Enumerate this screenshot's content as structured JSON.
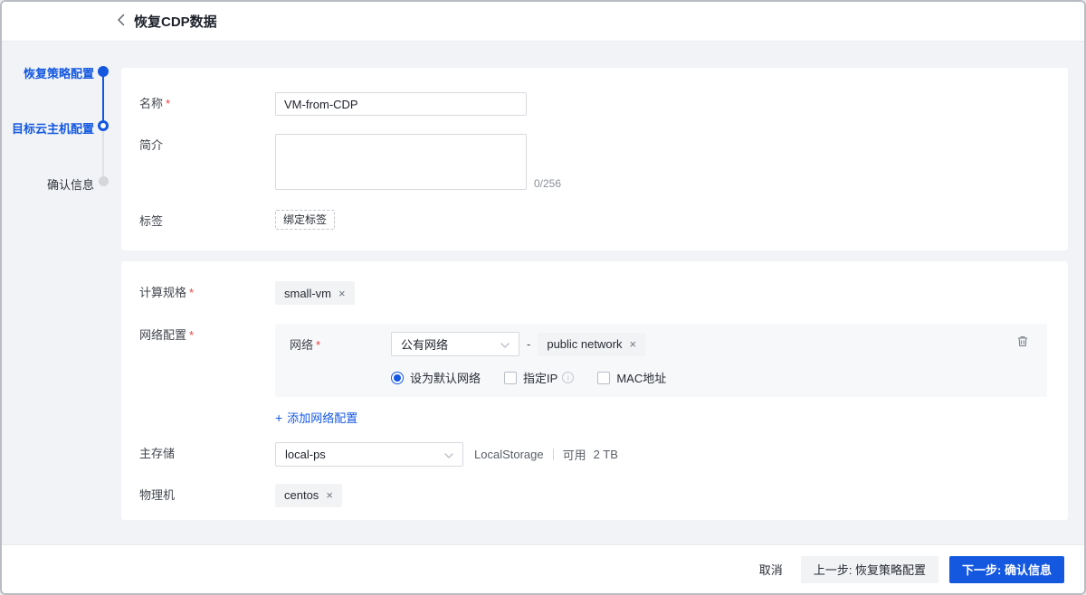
{
  "header": {
    "title": "恢复CDP数据"
  },
  "stepper": {
    "steps": [
      {
        "label": "恢复策略配置",
        "state": "done"
      },
      {
        "label": "目标云主机配置",
        "state": "current"
      },
      {
        "label": "确认信息",
        "state": "pending"
      }
    ]
  },
  "form": {
    "required_mark": "*",
    "name": {
      "label": "名称",
      "value": "VM-from-CDP"
    },
    "description": {
      "label": "简介",
      "value": "",
      "counter": "0/256"
    },
    "tag": {
      "label": "标签",
      "bind_button": "绑定标签"
    },
    "instance_offering": {
      "label": "计算规格",
      "tag": "small-vm",
      "remove": "×"
    },
    "network_config": {
      "label": "网络配置",
      "network": {
        "label": "网络",
        "select_value": "公有网络",
        "dash": "-",
        "tag": "public network",
        "remove": "×"
      },
      "options": {
        "default_network": "设为默认网络",
        "specify_ip": "指定IP",
        "info": "i",
        "mac": "MAC地址"
      },
      "add_icon": "+",
      "add_label": "添加网络配置"
    },
    "primary_storage": {
      "label": "主存储",
      "select_value": "local-ps",
      "type": "LocalStorage",
      "available_label": "可用",
      "available_value": "2 TB"
    },
    "host": {
      "label": "物理机",
      "tag": "centos",
      "remove": "×"
    }
  },
  "footer": {
    "cancel": "取消",
    "prev": "上一步: 恢复策略配置",
    "next": "下一步: 确认信息"
  },
  "colors": {
    "primary": "#1458e0",
    "content_bg": "#f1f3f6",
    "panel_bg": "#f7f8fa",
    "tag_bg": "#f2f3f5"
  }
}
